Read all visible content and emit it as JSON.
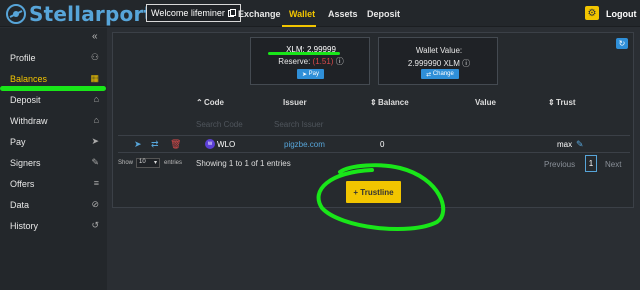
{
  "app": {
    "brand": "Stellarport"
  },
  "header": {
    "welcome": "Welcome lifeminer",
    "nav": [
      "Exchange",
      "Wallet",
      "Assets",
      "Deposit"
    ],
    "logout": "Logout"
  },
  "sidebar": {
    "items": [
      {
        "label": "Profile",
        "icon": "user-icon"
      },
      {
        "label": "Balances",
        "icon": "grid-icon"
      },
      {
        "label": "Deposit",
        "icon": "bank-icon"
      },
      {
        "label": "Withdraw",
        "icon": "bank-icon"
      },
      {
        "label": "Pay",
        "icon": "send-icon"
      },
      {
        "label": "Signers",
        "icon": "pencil-icon"
      },
      {
        "label": "Offers",
        "icon": "sliders-icon"
      },
      {
        "label": "Data",
        "icon": "paperclip-icon"
      },
      {
        "label": "History",
        "icon": "history-icon"
      }
    ],
    "active": "Balances"
  },
  "summary": {
    "xlm": "XLM: 2.99999",
    "reserve_label": "Reserve:",
    "reserve_value": "(1.51)",
    "pay": "Pay",
    "wallet_value_label": "Wallet Value:",
    "wallet_value": "2.999990 XLM",
    "change": "Change"
  },
  "table": {
    "headers": [
      "Code",
      "Issuer",
      "Balance",
      "Value",
      "Trust"
    ],
    "filter_code": "Search Code",
    "filter_issuer": "Search Issuer",
    "rows": [
      {
        "code": "WLO",
        "issuer": "pigzbe.com",
        "balance": "0",
        "value": "",
        "trust": "max"
      }
    ]
  },
  "pagination": {
    "show": "Show",
    "page_size": "10",
    "entries": "entries",
    "info": "Showing 1 to 1 of 1 entries",
    "previous": "Previous",
    "page": "1",
    "next": "Next"
  },
  "actions": {
    "trustline": "+ Trustline"
  },
  "colors": {
    "accent": "#f2c500",
    "link": "#57a5d9",
    "annotation": "#19e619",
    "danger": "#d84a4a"
  }
}
